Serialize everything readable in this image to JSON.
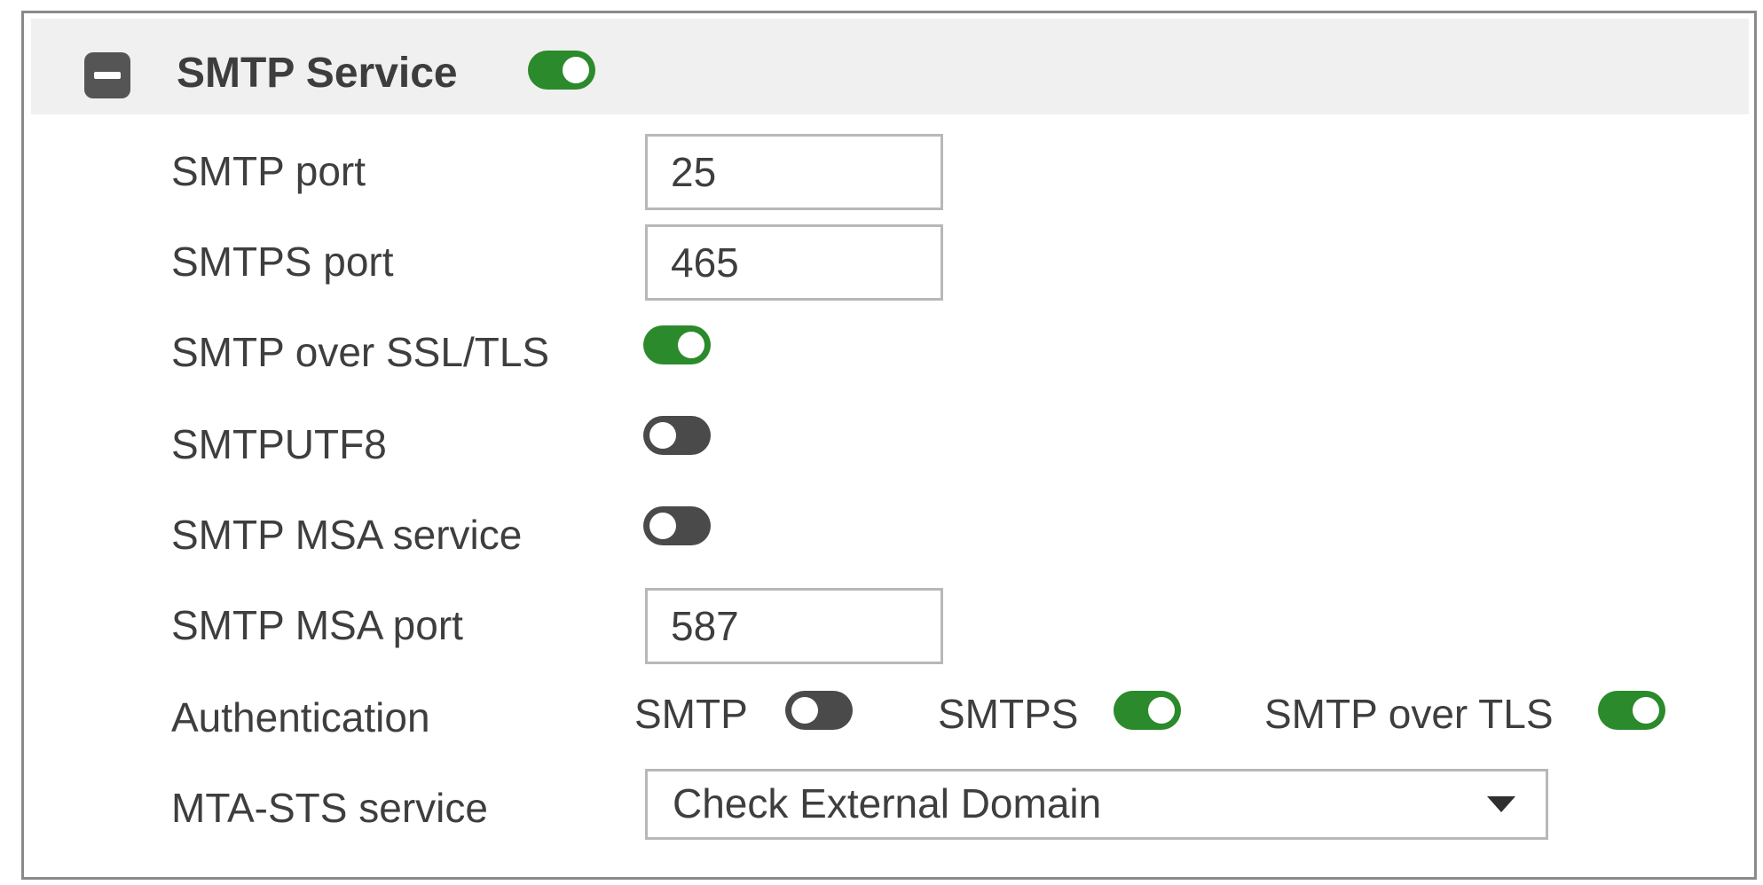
{
  "section": {
    "title": "SMTP Service",
    "enabled": true,
    "collapse_icon": "minus-square-icon"
  },
  "fields": {
    "smtp_port": {
      "label": "SMTP port",
      "value": "25"
    },
    "smtps_port": {
      "label": "SMTPS port",
      "value": "465"
    },
    "smtp_ssl_tls": {
      "label": "SMTP over SSL/TLS",
      "enabled": true
    },
    "smtputf8": {
      "label": "SMTPUTF8",
      "enabled": false
    },
    "msa_service": {
      "label": "SMTP MSA service",
      "enabled": false
    },
    "msa_port": {
      "label": "SMTP MSA port",
      "value": "587"
    },
    "authentication": {
      "label": "Authentication",
      "options": [
        {
          "label": "SMTP",
          "enabled": false
        },
        {
          "label": "SMTPS",
          "enabled": true
        },
        {
          "label": "SMTP over TLS",
          "enabled": true
        }
      ]
    },
    "mta_sts": {
      "label": "MTA-STS service",
      "value": "Check External Domain"
    }
  },
  "colors": {
    "toggle_on": "#2b8a2b",
    "toggle_off": "#4a4a4a",
    "header_bg": "#f0f0f0"
  }
}
